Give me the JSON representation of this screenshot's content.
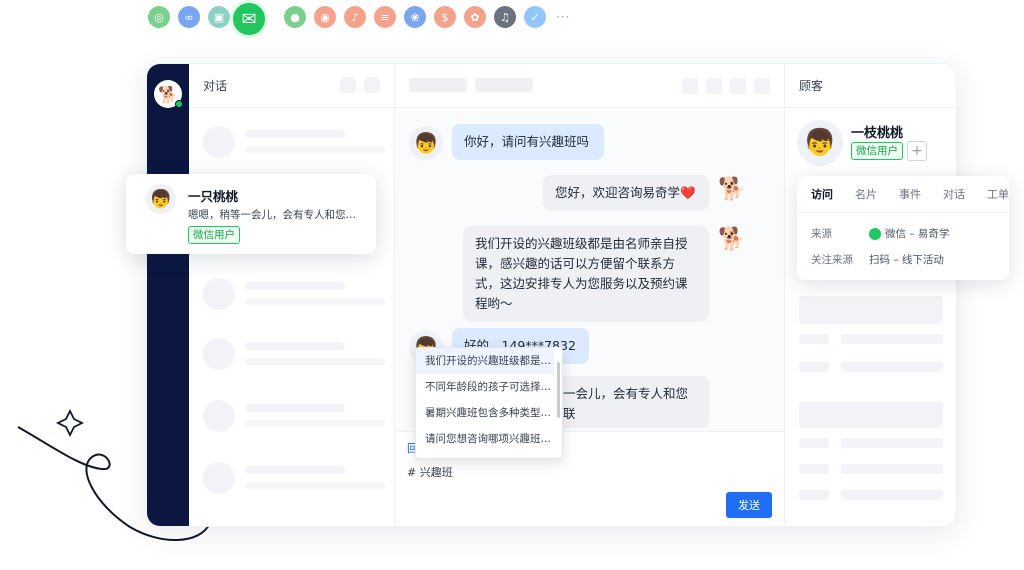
{
  "channels": [
    {
      "name": "web-icon",
      "color": "#7ccf8e",
      "glyph": "◎"
    },
    {
      "name": "link-icon",
      "color": "#7aa6f0",
      "glyph": "∞"
    },
    {
      "name": "card-icon",
      "color": "#8fd0c4",
      "glyph": "▣"
    },
    {
      "name": "wechat-icon",
      "color": "#22c55e",
      "glyph": "✉",
      "active": true
    },
    {
      "name": "message-icon",
      "color": "#7ccf8e",
      "glyph": "●"
    },
    {
      "name": "weibo-icon",
      "color": "#f4a28c",
      "glyph": "◉"
    },
    {
      "name": "music-icon",
      "color": "#f4a28c",
      "glyph": "♪"
    },
    {
      "name": "book-icon",
      "color": "#f4a28c",
      "glyph": "≡"
    },
    {
      "name": "paw-icon",
      "color": "#7aa6f0",
      "glyph": "❀"
    },
    {
      "name": "coin-icon",
      "color": "#f4a28c",
      "glyph": "$"
    },
    {
      "name": "store-icon",
      "color": "#f4a28c",
      "glyph": "✿"
    },
    {
      "name": "tiktok-icon",
      "color": "#6b7280",
      "glyph": "♫"
    },
    {
      "name": "feather-icon",
      "color": "#93c5fd",
      "glyph": "✓"
    }
  ],
  "channels_more": "···",
  "conversations": {
    "header": "对话"
  },
  "contact_card": {
    "name": "一只桃桃",
    "preview": "嗯嗯，稍等一会儿，会有专人和您联…",
    "tag": "微信用户"
  },
  "chat": {
    "messages": [
      {
        "from": "customer",
        "text": "你好，请问有兴趣班吗"
      },
      {
        "from": "bot",
        "text": "您好，欢迎咨询易奇学❤️"
      },
      {
        "from": "bot",
        "text": "我们开设的兴趣班级都是由名师亲自授课，感兴趣的话可以方便留个联系方式，这边安排专人为您服务以及预约课程哟～"
      },
      {
        "from": "customer",
        "text": "好的，149***7832"
      },
      {
        "from": "bot",
        "text": "一会儿，会有专人和您联"
      }
    ],
    "composer_tool": "回",
    "composer_text": "# 兴趣班",
    "send_label": "发送",
    "suggestions": [
      "我们开设的兴趣班级都是…",
      "不同年龄段的孩子可选择…",
      "暑期兴趣班包含多种类型…",
      "请问您想咨询哪项兴趣班…"
    ]
  },
  "customer": {
    "header": "顾客",
    "name": "一枝桃桃",
    "tag": "微信用户",
    "add_label": "+",
    "tabs": [
      "访问",
      "名片",
      "事件",
      "对话",
      "工单"
    ],
    "active_tab": "访问",
    "source_label": "来源",
    "source_value": "微信 – 易奇学",
    "follow_label": "关注来源",
    "follow_value": "扫码 – 线下活动"
  }
}
